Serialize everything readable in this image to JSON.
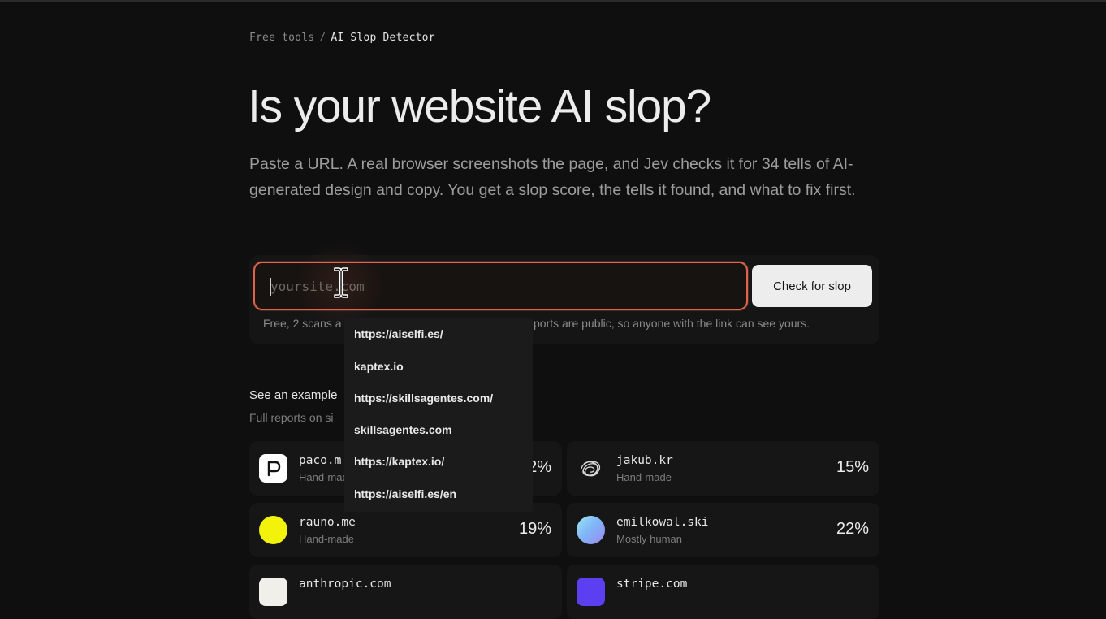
{
  "breadcrumb": {
    "parent": "Free tools",
    "separator": "/",
    "current": "AI Slop Detector"
  },
  "hero": {
    "title": "Is your website AI slop?",
    "description": "Paste a URL. A real browser screenshots the page, and Jev checks it for 34 tells of AI-generated design and copy. You get a slop score, the tells it found, and what to fix first."
  },
  "scan": {
    "placeholder": "yoursite.com",
    "value": "",
    "button_label": "Check for slop",
    "hint_left": "Free, 2 scans a",
    "hint_right": "ports are public, so anyone with the link can see yours.",
    "accent_color": "#e0644a"
  },
  "autocomplete": {
    "options": [
      "https://aiselfi.es/",
      "kaptex.io",
      "https://skillsagentes.com/",
      "skillsagentes.com",
      "https://kaptex.io/",
      "https://aiselfi.es/en"
    ]
  },
  "examples": {
    "title": "See an example",
    "subtitle": "Full reports on si",
    "items": [
      {
        "domain": "paco.m",
        "verdict": "Hand-mad",
        "score": "2%",
        "icon": "paco-logo-icon"
      },
      {
        "domain": "jakub.kr",
        "verdict": "Hand-made",
        "score": "15%",
        "icon": "scribble-avatar-icon"
      },
      {
        "domain": "rauno.me",
        "verdict": "Hand-made",
        "score": "19%",
        "icon": "yellow-circle-icon",
        "icon_color": "#f2f20a"
      },
      {
        "domain": "emilkowal.ski",
        "verdict": "Mostly human",
        "score": "22%",
        "icon": "gradient-circle-icon"
      },
      {
        "domain": "anthropic.com",
        "verdict": "",
        "score": "",
        "icon": "anthropic-logo-icon"
      },
      {
        "domain": "stripe.com",
        "verdict": "",
        "score": "",
        "icon": "stripe-logo-icon",
        "icon_color": "#5b3ff0"
      }
    ]
  }
}
